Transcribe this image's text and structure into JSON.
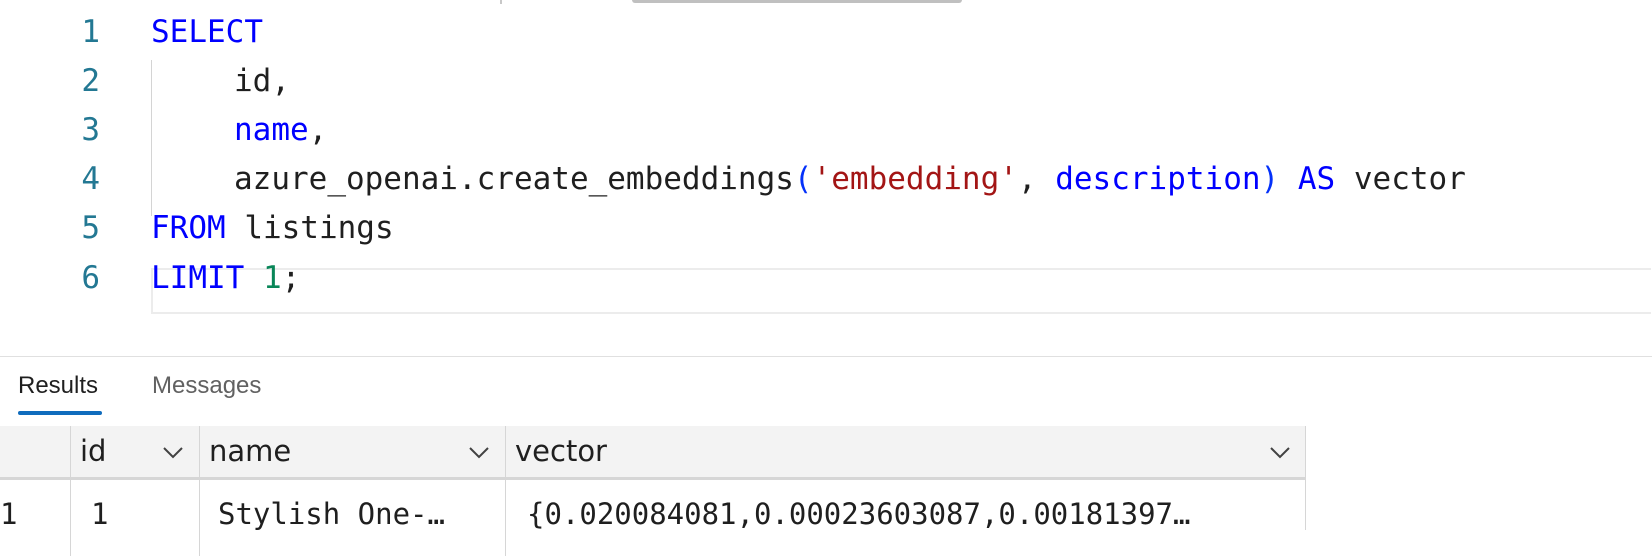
{
  "editor": {
    "lines": [
      {
        "num": "1",
        "parts": [
          {
            "t": "SELECT",
            "c": "kw"
          }
        ]
      },
      {
        "num": "2",
        "parts": [
          {
            "t": "id,",
            "c": "fnc"
          }
        ]
      },
      {
        "num": "3",
        "parts": [
          {
            "t": "name",
            "c": "ident"
          },
          {
            "t": ",",
            "c": "fnc"
          }
        ]
      },
      {
        "num": "4",
        "parts": [
          {
            "t": "azure_openai.create_embeddings",
            "c": "fnc"
          },
          {
            "t": "(",
            "c": "paren"
          },
          {
            "t": "'embedding'",
            "c": "str"
          },
          {
            "t": ", ",
            "c": "fnc"
          },
          {
            "t": "description",
            "c": "ident"
          },
          {
            "t": ")",
            "c": "paren"
          },
          {
            "t": " AS ",
            "c": "kw"
          },
          {
            "t": "vector",
            "c": "fnc"
          }
        ]
      },
      {
        "num": "5",
        "parts": [
          {
            "t": "FROM",
            "c": "kw"
          },
          {
            "t": " listings",
            "c": "fnc"
          }
        ]
      },
      {
        "num": "6",
        "parts": [
          {
            "t": "LIMIT",
            "c": "kw"
          },
          {
            "t": " ",
            "c": "fnc"
          },
          {
            "t": "1",
            "c": "num"
          },
          {
            "t": ";",
            "c": "fnc"
          }
        ]
      }
    ]
  },
  "results": {
    "tabs": {
      "results": "Results",
      "messages": "Messages"
    },
    "columns": {
      "id": "id",
      "name": "name",
      "vector": "vector"
    },
    "row": {
      "index": "1",
      "id": "1",
      "name": "Stylish One-…",
      "vector": "{0.020084081,0.00023603087,0.00181397…"
    }
  },
  "colors": {
    "accent": "#0f6cbd",
    "keyword": "#0000ff",
    "string": "#a31515",
    "number": "#098658",
    "line_number": "#237893"
  }
}
